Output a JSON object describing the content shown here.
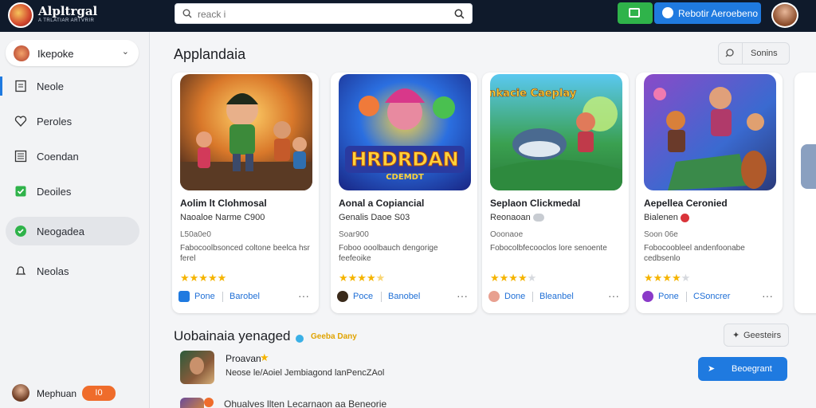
{
  "header": {
    "brand": "Alpltrgal",
    "brand_sub": "A TRLATIAR ARTVRIR",
    "search_placeholder": "reack i",
    "primary_action": "Rebotir Aeroebeno"
  },
  "sidebar": {
    "profile_label": "Ikepoke",
    "items": [
      {
        "label": "Neole"
      },
      {
        "label": "Peroles"
      },
      {
        "label": "Coendan"
      },
      {
        "label": "Deoiles"
      },
      {
        "label": "Neogadea"
      },
      {
        "label": "Neolas"
      }
    ],
    "footer_user": "Mephuan",
    "footer_badge": "I0"
  },
  "section": {
    "title": "Applandaia",
    "see_all": "Sonins"
  },
  "cards": [
    {
      "title": "Aolim lt Clohmosal",
      "subtitle": "Naoaloe Narme C900",
      "meta": "L50a0e0",
      "desc": "Fabocoolbsonced coltone beelca hsr ferel",
      "stars": 5,
      "link1": "Pone",
      "link2": "Barobel",
      "art_text": ""
    },
    {
      "title": "Aonal a Copiancial",
      "subtitle": "Genalis Daoe S03",
      "meta": "Soar900",
      "desc": "Foboo ooolbauch dengorige feefeoike",
      "stars": 4.5,
      "link1": "Poce",
      "link2": "Banobel",
      "art_text": "HRDRDAN",
      "art_sub": "CDEMDT"
    },
    {
      "title": "Seplaon Clickmedal",
      "subtitle": "Reonaoan",
      "meta": "Ooonaoe",
      "desc": "Fobocolbfecooclos lore senoente",
      "stars": 4,
      "link1": "Done",
      "link2": "Bleanbel",
      "art_text": "Conkacie Caeplay"
    },
    {
      "title": "Aepellea Ceronied",
      "subtitle": "Bialenen",
      "meta": "Soon 06e",
      "desc": "Fobocoobleel andenfoonabe cedbsenlo",
      "stars": 4,
      "link1": "Pone",
      "link2": "CSoncrer",
      "art_text": ""
    }
  ],
  "section2": {
    "title": "Uobainaia yenaged",
    "badge": "Geeba Dany",
    "details": "Geesteirs"
  },
  "rows": [
    {
      "title": "Proavan",
      "desc": "Neose le/Aoiel Jembiagond lanPencZAol",
      "action": "Beoegrant"
    },
    {
      "title": "Ohualves llten Lecarnaon aa Beneorie"
    }
  ],
  "colors": {
    "topbar": "#0f1a2b",
    "accent_blue": "#1f7ae0",
    "accent_green": "#2fb34a",
    "star": "#f5b400",
    "badge_orange": "#ef6c2b"
  }
}
